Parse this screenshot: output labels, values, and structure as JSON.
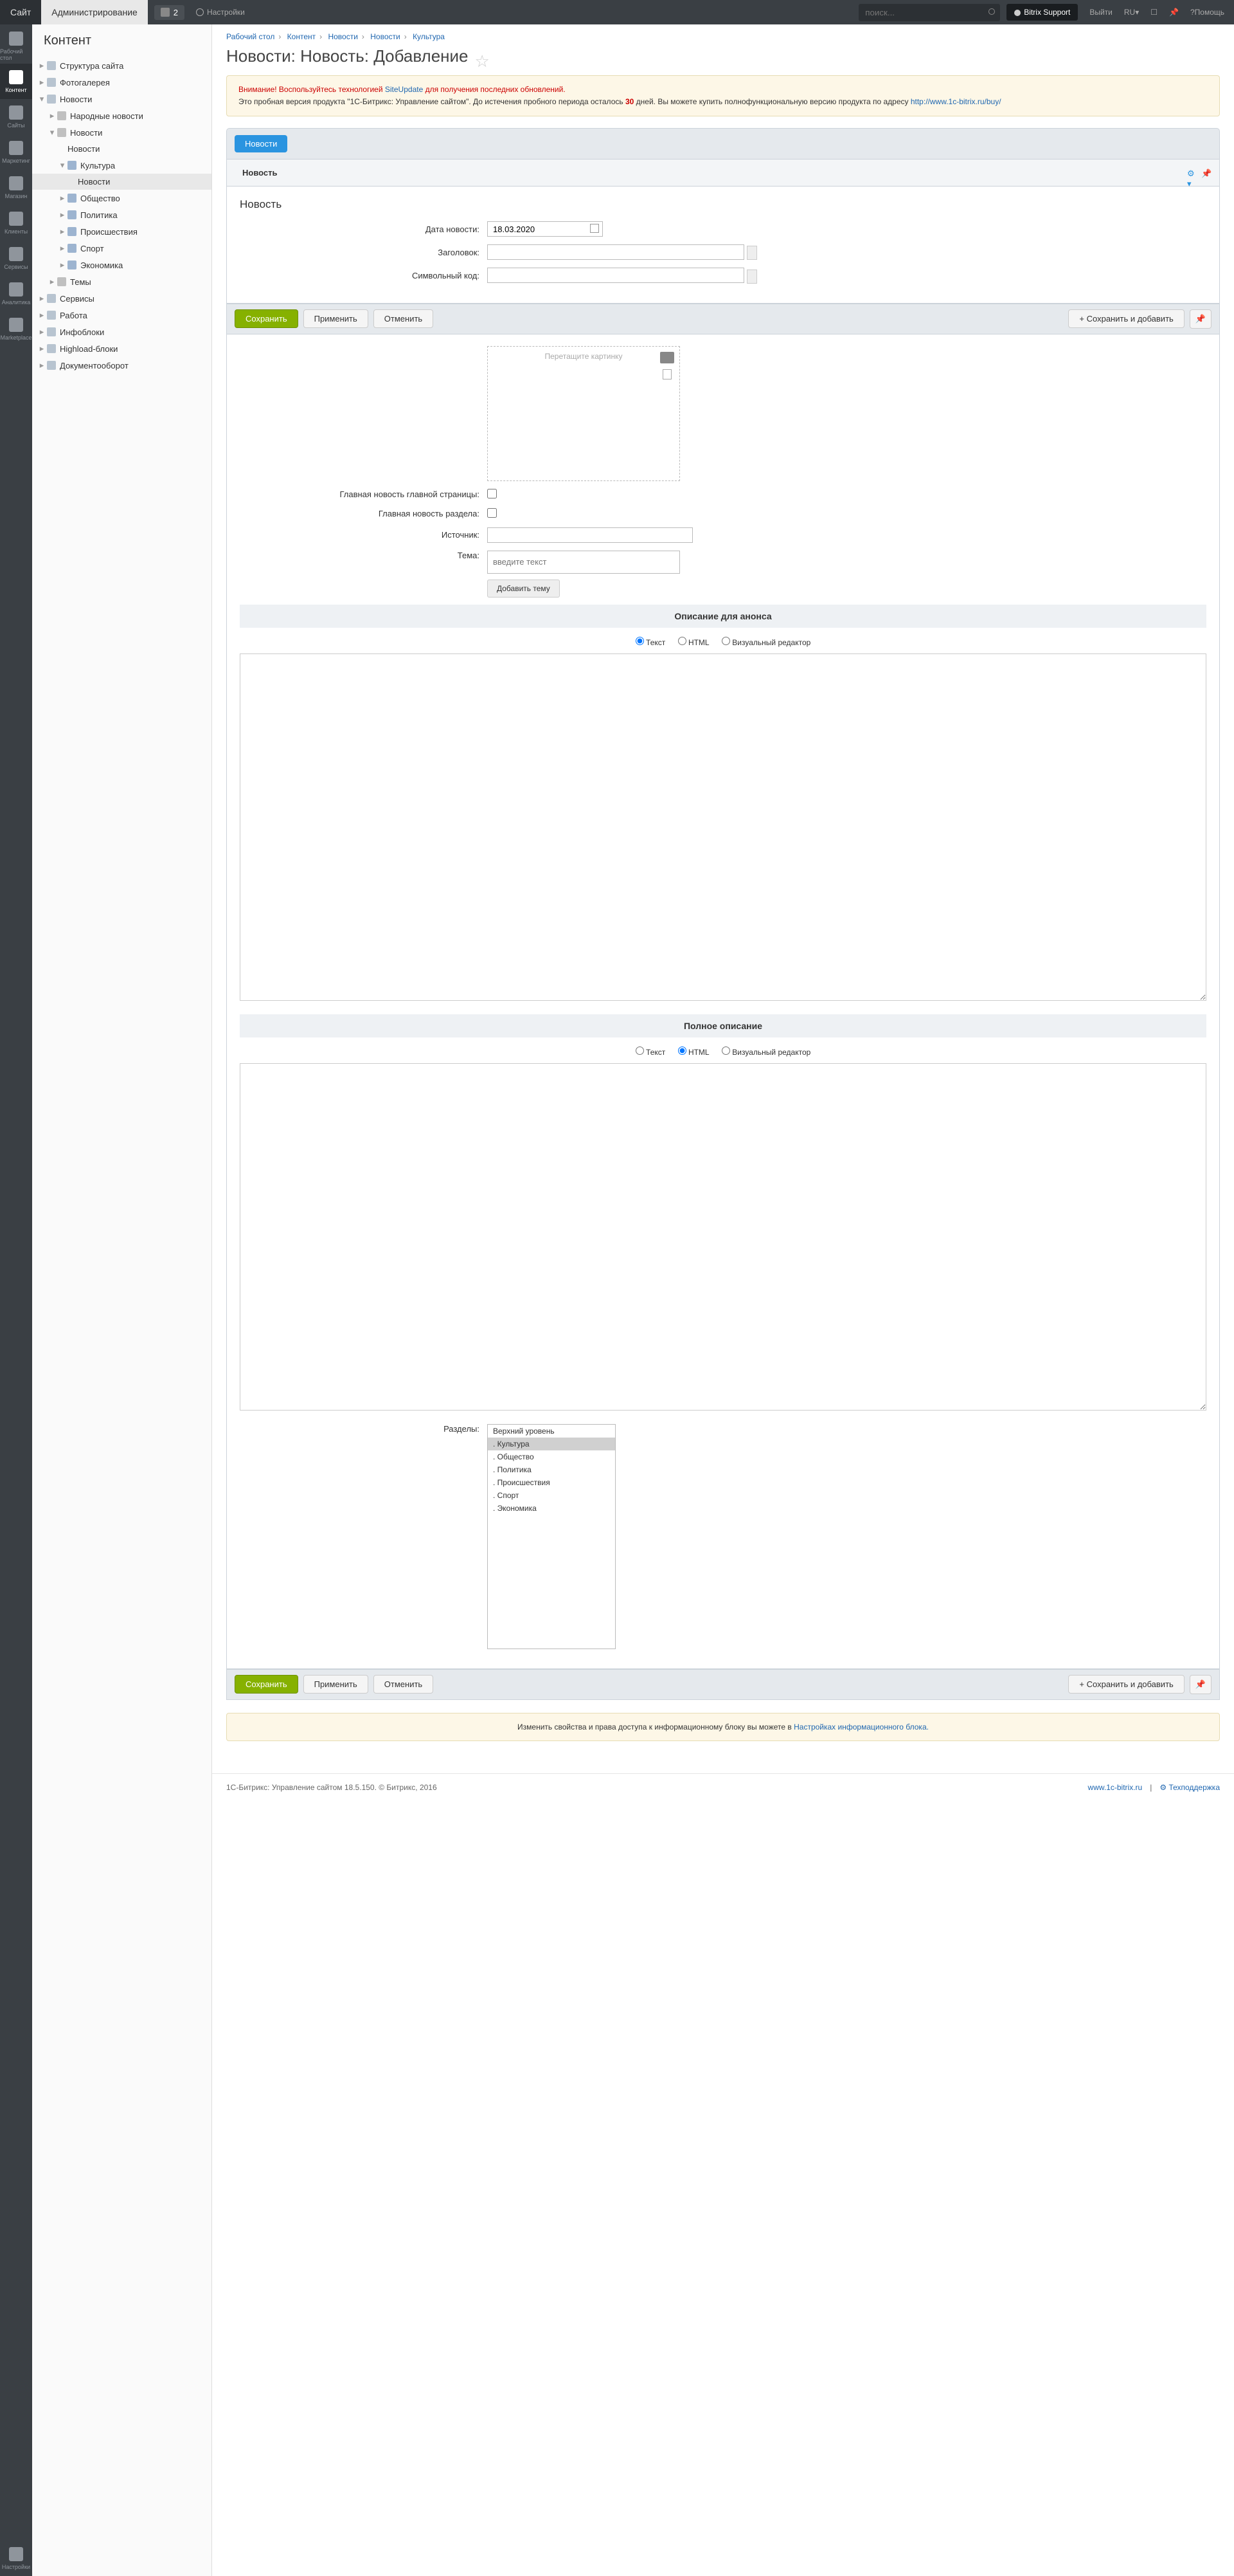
{
  "top": {
    "tab_site": "Сайт",
    "tab_admin": "Администрирование",
    "notif_count": "2",
    "settings": "Настройки",
    "search_ph": "поиск...",
    "user": "Bitrix Support",
    "logout": "Выйти",
    "lang": "RU",
    "help": "Помощь"
  },
  "rail": {
    "desktop": "Рабочий стол",
    "content": "Контент",
    "sites": "Сайты",
    "marketing": "Маркетинг",
    "shop": "Магазин",
    "clients": "Клиенты",
    "services": "Сервисы",
    "analytics": "Аналитика",
    "marketplace": "Marketplace",
    "settings": "Настройки"
  },
  "tree": {
    "title": "Контент",
    "struct": "Структура сайта",
    "photo": "Фотогалерея",
    "news": "Новости",
    "news_folk": "Народные новости",
    "news2": "Новости",
    "news3": "Новости",
    "culture": "Культура",
    "news4": "Новости",
    "society": "Общество",
    "politics": "Политика",
    "incidents": "Происшествия",
    "sport": "Спорт",
    "economy": "Экономика",
    "themes": "Темы",
    "services": "Сервисы",
    "work": "Работа",
    "iblocks": "Инфоблоки",
    "highload": "Highload-блоки",
    "docflow": "Документооборот"
  },
  "crumbs": {
    "c1": "Рабочий стол",
    "c2": "Контент",
    "c3": "Новости",
    "c4": "Новости",
    "c5": "Культура"
  },
  "title": "Новости: Новость: Добавление",
  "alert": {
    "warn": "Внимание! Воспользуйтесь технологией ",
    "su": "SiteUpdate",
    "warn2": " для получения последних обновлений.",
    "trial1": "Это пробная версия продукта \"1С-Битрикс: Управление сайтом\". До истечения пробного периода осталось ",
    "days": "30",
    "trial2": " дней. Вы можете купить полнофункциональную версию продукта по адресу ",
    "url": "http://www.1c-bitrix.ru/buy/"
  },
  "tabs": {
    "news": "Новости",
    "item": "Новость"
  },
  "form": {
    "sect_title": "Новость",
    "lab_date": "Дата новости:",
    "val_date": "18.03.2020",
    "lab_head": "Заголовок:",
    "lab_code": "Символьный код:",
    "drag": "Перетащите картинку",
    "lab_mainpage": "Главная новость главной страницы:",
    "lab_mainsect": "Главная новость раздела:",
    "lab_source": "Источник:",
    "lab_theme": "Тема:",
    "theme_ph": "введите текст",
    "add_theme": "Добавить тему",
    "sect_preview": "Описание для анонса",
    "sect_detail": "Полное описание",
    "r_text": "Текст",
    "r_html": "HTML",
    "r_visual": "Визуальный редактор",
    "lab_sections": "Разделы:",
    "opts": {
      "top": "Верхний уровень",
      "culture": ". Культура",
      "society": ". Общество",
      "politics": ". Политика",
      "incidents": ". Происшествия",
      "sport": ". Спорт",
      "economy": ". Экономика"
    }
  },
  "btns": {
    "save": "Сохранить",
    "apply": "Применить",
    "cancel": "Отменить",
    "save_add": "Сохранить и добавить"
  },
  "hint": {
    "t1": "Изменить свойства и права доступа к информационному блоку вы можете в ",
    "link": "Настройках информационного блока.",
    "t2": ""
  },
  "foot": {
    "copy": "1С-Битрикс: Управление сайтом 18.5.150. © Битрикс, 2016",
    "site": "www.1c-bitrix.ru",
    "support": "Техподдержка"
  }
}
